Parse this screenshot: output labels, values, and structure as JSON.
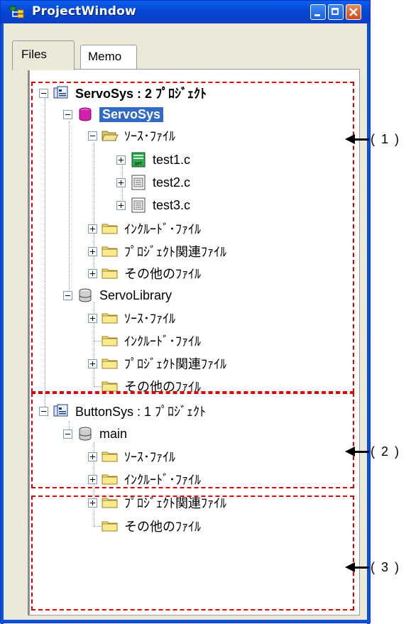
{
  "window": {
    "title": "ProjectWindow",
    "accent": "#0a52d8"
  },
  "tabs": [
    {
      "label": "Files",
      "active": true
    },
    {
      "label": "Memo",
      "active": false
    }
  ],
  "tree": [
    {
      "label": "ServoSys : 2 ﾌﾟﾛｼﾞｪｸﾄ",
      "icon": "workspace-icon"
    },
    {
      "label": "ServoSys",
      "icon": "project-active-icon"
    },
    {
      "label": "ｿｰｽ･ﾌｧｲﾙ",
      "icon": "open-folder-icon"
    },
    {
      "label": "test1.c",
      "icon": "file-opt-icon"
    },
    {
      "label": "test2.c",
      "icon": "file-icon"
    },
    {
      "label": "test3.c",
      "icon": "file-icon"
    },
    {
      "label": "ｲﾝｸﾙｰﾄﾞ･ﾌｧｲﾙ",
      "icon": "folder-icon"
    },
    {
      "label": "ﾌﾟﾛｼﾞｪｸﾄ関連ﾌｧｲﾙ",
      "icon": "folder-icon"
    },
    {
      "label": "その他のﾌｧｲﾙ",
      "icon": "folder-icon"
    },
    {
      "label": "ServoLibrary",
      "icon": "project-icon"
    },
    {
      "label": "ｿｰｽ･ﾌｧｲﾙ",
      "icon": "folder-icon"
    },
    {
      "label": "ｲﾝｸﾙｰﾄﾞ･ﾌｧｲﾙ",
      "icon": "folder-icon"
    },
    {
      "label": "ﾌﾟﾛｼﾞｪｸﾄ関連ﾌｧｲﾙ",
      "icon": "folder-icon"
    },
    {
      "label": "その他のﾌｧｲﾙ",
      "icon": "folder-icon"
    },
    {
      "label": "ButtonSys : 1 ﾌﾟﾛｼﾞｪｸﾄ",
      "icon": "workspace-icon"
    },
    {
      "label": "main",
      "icon": "project-icon"
    },
    {
      "label": "ｿｰｽ･ﾌｧｲﾙ",
      "icon": "folder-icon"
    },
    {
      "label": "ｲﾝｸﾙｰﾄﾞ･ﾌｧｲﾙ",
      "icon": "folder-icon"
    },
    {
      "label": "ﾌﾟﾛｼﾞｪｸﾄ関連ﾌｧｲﾙ",
      "icon": "folder-icon"
    },
    {
      "label": "その他のﾌｧｲﾙ",
      "icon": "folder-icon"
    }
  ],
  "annotations": {
    "region1": "( 1 )",
    "region2": "( 2 )",
    "region3": "( 3 )",
    "color": "#e00000"
  }
}
